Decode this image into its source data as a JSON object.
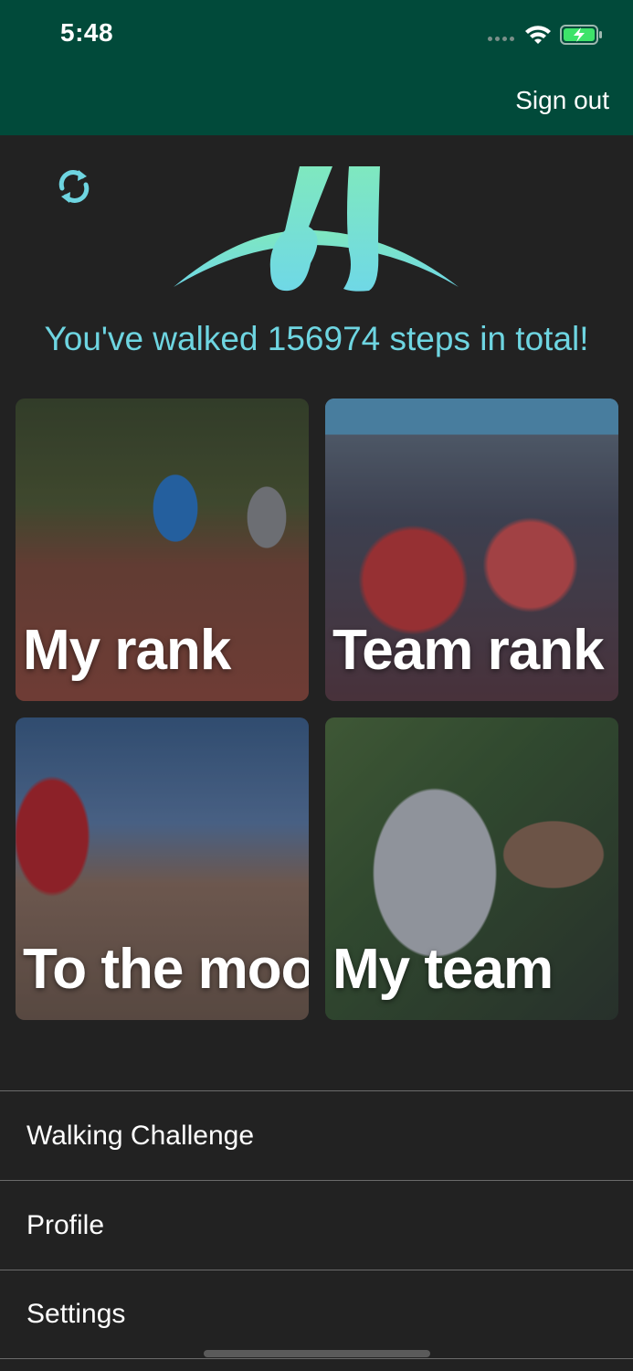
{
  "status_bar": {
    "time": "5:48"
  },
  "header": {
    "sign_out_label": "Sign out"
  },
  "hero": {
    "steps_text": "You've walked 156974 steps in total!"
  },
  "tiles": [
    {
      "label": "My rank"
    },
    {
      "label": "Team rank"
    },
    {
      "label": "To the moon"
    },
    {
      "label": "My team"
    }
  ],
  "menu": {
    "items": [
      {
        "label": "Walking Challenge"
      },
      {
        "label": "Profile"
      },
      {
        "label": "Settings"
      }
    ]
  },
  "colors": {
    "header_bg": "#014a3a",
    "page_bg": "#222222",
    "accent": "#6ed5e1"
  }
}
